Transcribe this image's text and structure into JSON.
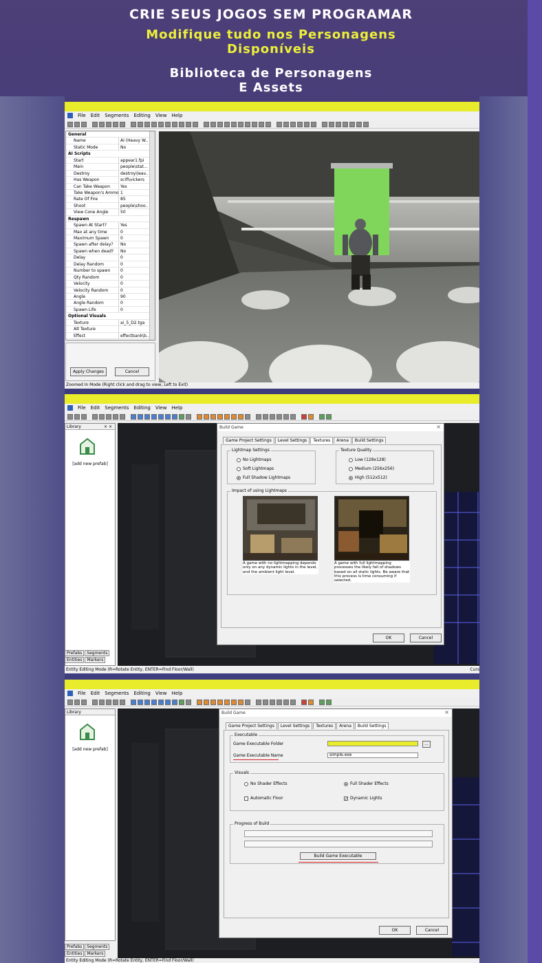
{
  "header": {
    "line1": "CRIE SEUS JOGOS SEM PROGRAMAR",
    "line2a": "Modifique tudo nos Personagens",
    "line2b": "Disponíveis",
    "line3a": "Biblioteca de Personagens",
    "line3b": "E Assets"
  },
  "menu": [
    "File",
    "Edit",
    "Segments",
    "Editing",
    "View",
    "Help"
  ],
  "shot1": {
    "properties": [
      {
        "section": "General"
      },
      {
        "key": "Name",
        "value": "AI (Heavy W..."
      },
      {
        "key": "Static Mode",
        "value": "No"
      },
      {
        "section": "AI Scripts"
      },
      {
        "key": "Start",
        "value": "appear1.fpi"
      },
      {
        "key": "Main",
        "value": "people\\stat..."
      },
      {
        "key": "Destroy",
        "value": "destroy\\leav..."
      },
      {
        "key": "Has Weapon",
        "value": "scifi\\vickers"
      },
      {
        "key": "Can Take Weapon",
        "value": "Yes"
      },
      {
        "key": "Take Weapon's Ammo",
        "value": "1"
      },
      {
        "key": "Rate Of Fire",
        "value": "85"
      },
      {
        "key": "Shoot",
        "value": "people\\shoo..."
      },
      {
        "key": "View Cone Angle",
        "value": "50"
      },
      {
        "section": "Respawn"
      },
      {
        "key": "Spawn At Start?",
        "value": "Yes"
      },
      {
        "key": "Max at any time",
        "value": "0"
      },
      {
        "key": "Maximum Spawn",
        "value": "0"
      },
      {
        "key": "Spawn after delay?",
        "value": "No"
      },
      {
        "key": "Spawn when dead?",
        "value": "No"
      },
      {
        "key": "Delay",
        "value": "0"
      },
      {
        "key": "Delay Random",
        "value": "0"
      },
      {
        "key": "Number to spawn",
        "value": "0"
      },
      {
        "key": "Qty Random",
        "value": "0"
      },
      {
        "key": "Velocity",
        "value": "0"
      },
      {
        "key": "Velocity Random",
        "value": "0"
      },
      {
        "key": "Angle",
        "value": "90"
      },
      {
        "key": "Angle Random",
        "value": "0"
      },
      {
        "key": "Spawn Life",
        "value": "0"
      },
      {
        "section": "Optional Visuals"
      },
      {
        "key": "Texture",
        "value": "ai_5_D2.tga"
      },
      {
        "key": "Alt Texture",
        "value": ""
      },
      {
        "key": "Effect",
        "value": "effectbank\\b..."
      }
    ],
    "apply_label": "Apply Changes",
    "cancel_label": "Cancel",
    "status": "Zoomed In Mode (Right click and drag to view, Left to Exit)"
  },
  "shot2": {
    "library_title": "Library",
    "library_close": "× ×",
    "prefab_caption": "[add new prefab]",
    "lib_tabs": [
      "Prefabs",
      "Segments",
      "Entities",
      "Markers"
    ],
    "dialog_title": "Build Game",
    "tabs": [
      "Game Project Settings",
      "Level Settings",
      "Textures",
      "Arena",
      "Build Settings"
    ],
    "active_tab": "Textures",
    "lightmap_group": "Lightmap Settings",
    "lightmap_options": [
      "No Lightmaps",
      "Soft Lightmaps",
      "Full Shadow Lightmaps"
    ],
    "quality_group": "Texture Quality",
    "quality_options": [
      "Low (128x128)",
      "Medium (256x256)",
      "High (512x512)"
    ],
    "impact_group": "Impact of using Lightmaps",
    "caption_left": "A game with no lightmapping depends only on any dynamic lights in the level, and the ambient light level.",
    "caption_right": "A game with full lightmapping processes the likely fall of shadows based on all static lights. Be aware that this process is time consuming if selected.",
    "ok": "OK",
    "cancel": "Cancel",
    "status": "Entity Editing Mode (R=Rotate Entity, ENTER=Find Floor/Wall)",
    "status_right": "Curs"
  },
  "shot3": {
    "dialog_title": "Build Game",
    "tabs": [
      "Game Project Settings",
      "Level Settings",
      "Textures",
      "Arena",
      "Build Settings"
    ],
    "active_tab": "Build Settings",
    "exec_group": "Executable",
    "folder_label": "Game Executable Folder",
    "folder_value": "",
    "browse": "...",
    "name_label": "Game Executable Name",
    "name_value": "simple.exe",
    "visuals_group": "Visuals",
    "no_shader": "No Shader Effects",
    "full_shader": "Full Shader Effects",
    "auto_floor": "Automatic Floor",
    "dynamic_lights": "Dynamic Lights",
    "progress_group": "Progress of Build",
    "build_button": "Build Game Executable",
    "ok": "OK",
    "cancel": "Cancel",
    "status": "Entity Editing Mode (R=Rotate Entity, ENTER=Find Floor/Wall)"
  },
  "colors": {
    "highlight_yellow": "#e8ec2a",
    "headline_yellow": "#eef03a",
    "underline_red": "#d42020"
  }
}
